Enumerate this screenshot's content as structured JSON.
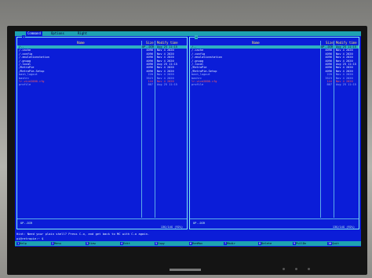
{
  "menu": [
    {
      "label": "Command",
      "active": true
    },
    {
      "label": "Options",
      "active": false
    },
    {
      "label": "Right",
      "active": false
    }
  ],
  "left_panel": {
    "path": "~",
    "columns": {
      "name": "Name",
      "size": "Size",
      "mtime": "Modify time"
    },
    "rows": [
      {
        "name": "/..",
        "size": "UP--DIR",
        "mtime": "Aug 25 11:15",
        "style": "sel"
      },
      {
        "name": "/.cache",
        "size": "4096",
        "mtime": "Nov  4  2020",
        "style": ""
      },
      {
        "name": "/.config",
        "size": "4096",
        "mtime": "Nov  4  2020",
        "style": ""
      },
      {
        "name": "/.emulationstation",
        "size": "4096",
        "mtime": "Nov  4  2020",
        "style": ""
      },
      {
        "name": "/.gnupg",
        "size": "4096",
        "mtime": "Nov  4  2020",
        "style": ""
      },
      {
        "name": "/.local",
        "size": "4096",
        "mtime": "Aug 25 11:15",
        "style": ""
      },
      {
        "name": "/RetroPie",
        "size": "4096",
        "mtime": "Nov  4  2020",
        "style": ""
      },
      {
        "name": "/RetroPie-Setup",
        "size": "4096",
        "mtime": "Nov  4  2020",
        "style": ""
      },
      {
        "name": " bash_logout",
        "size": "220",
        "mtime": "Nov  4  2020",
        "style": "link"
      },
      {
        "name": " bashrc",
        "size": "3523",
        "mtime": "Nov  4  2020",
        "style": "link"
      },
      {
        "name": " lr-vice2000.cfg",
        "size": "144",
        "mtime": "Nov  4  2020",
        "style": "red"
      },
      {
        "name": " profile",
        "size": "807",
        "mtime": "Aug 25 11:15",
        "style": "link"
      }
    ],
    "mini_status": "UP--DIR",
    "free": "13G/14G (92%)"
  },
  "right_panel": {
    "path": "~",
    "columns": {
      "name": "Name",
      "size": "Size",
      "mtime": "Modify time"
    },
    "rows": [
      {
        "name": "/..",
        "size": "UP--DIR",
        "mtime": "Aug 25 11:15",
        "style": "sel"
      },
      {
        "name": "/.cache",
        "size": "4096",
        "mtime": "Nov  4  2020",
        "style": ""
      },
      {
        "name": "/.config",
        "size": "4096",
        "mtime": "Nov  4  2020",
        "style": ""
      },
      {
        "name": "/.emulationstation",
        "size": "4096",
        "mtime": "Nov  4  2020",
        "style": ""
      },
      {
        "name": "/.gnupg",
        "size": "4096",
        "mtime": "Nov  4  2020",
        "style": ""
      },
      {
        "name": "/.local",
        "size": "4096",
        "mtime": "Aug 25 11:15",
        "style": ""
      },
      {
        "name": "/RetroPie",
        "size": "4096",
        "mtime": "Nov  4  2020",
        "style": ""
      },
      {
        "name": "/RetroPie-Setup",
        "size": "4096",
        "mtime": "Nov  4  2020",
        "style": ""
      },
      {
        "name": " bash_logout",
        "size": "220",
        "mtime": "Nov  4  2020",
        "style": "link"
      },
      {
        "name": " bashrc",
        "size": "3523",
        "mtime": "Nov  4  2020",
        "style": "link"
      },
      {
        "name": " lr-vice2000.cfg",
        "size": "144",
        "mtime": "Nov  4  2020",
        "style": "red"
      },
      {
        "name": " profile",
        "size": "807",
        "mtime": "Aug 25 11:15",
        "style": "link"
      }
    ],
    "mini_status": "UP--DIR",
    "free": "13G/14G (92%)"
  },
  "hint": "Hint: Need your plain shell? Press C-o, and get back to MC with C-o again.",
  "prompt": "pi@retropie:~ $",
  "fkeys": [
    {
      "num": "1",
      "label": "Help"
    },
    {
      "num": "2",
      "label": "Menu"
    },
    {
      "num": "3",
      "label": "View"
    },
    {
      "num": "4",
      "label": "Edit"
    },
    {
      "num": "5",
      "label": "Copy"
    },
    {
      "num": "6",
      "label": "RenMov"
    },
    {
      "num": "7",
      "label": "Mkdir"
    },
    {
      "num": "8",
      "label": "Delete"
    },
    {
      "num": "9",
      "label": "PullDn"
    },
    {
      "num": "10",
      "label": "Quit"
    }
  ],
  "colors": {
    "background": "#0b1dd8",
    "accent": "#1ea3b2",
    "header": "#ffea6a",
    "error": "#ff5a5a"
  }
}
